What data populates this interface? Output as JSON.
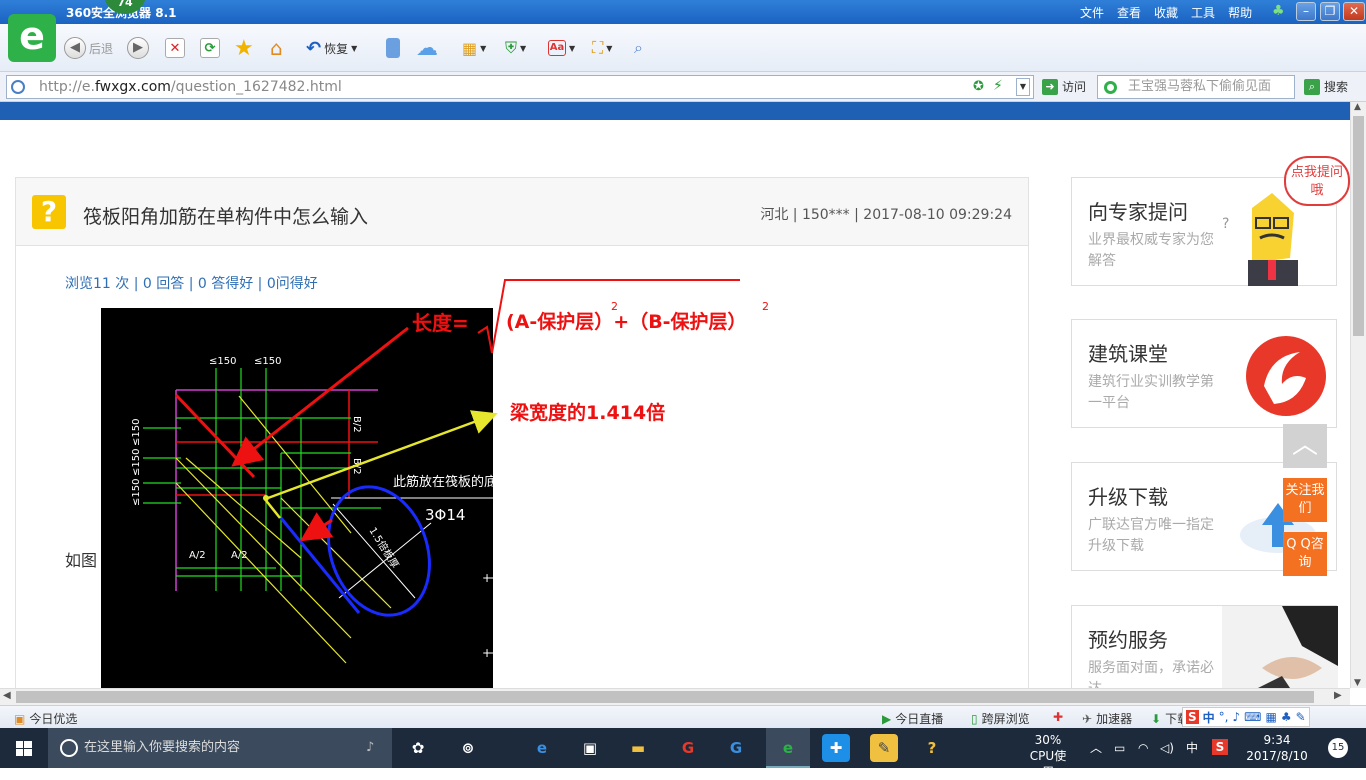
{
  "titlebar": {
    "title": "360安全浏览器 8.1",
    "badge": "74",
    "menu": [
      "文件",
      "查看",
      "收藏",
      "工具",
      "帮助"
    ]
  },
  "toolbar": {
    "back": "后退",
    "restore": "恢复"
  },
  "address": {
    "url_prefix": "http://e.",
    "url_domain": "fwxgx.com",
    "url_path": "/question_1627482.html",
    "visit": "访问",
    "search_value": "王宝强马蓉私下偷偷见面",
    "search_btn": "搜索"
  },
  "question": {
    "title": "筏板阳角加筋在单构件中怎么输入",
    "meta": "河北 | 150*** | 2017-08-10 09:29:24",
    "stats": "浏览11 次 | 0 回答 | 0 答得好 | 0问得好",
    "body_prefix": "如图"
  },
  "annotations": {
    "length_label": "长度=",
    "formula": "(A-保护层）+（B-保护层）",
    "sup": "2",
    "width_note": "梁宽度的1.414倍"
  },
  "cad": {
    "dim_150a": "≤150",
    "dim_150b": "≤150",
    "dim_b2a": "B/2",
    "dim_b2b": "B/2",
    "dim_a2a": "A/2",
    "dim_a2b": "A/2",
    "dim_150c": "≤150",
    "dim_150d": "≤150",
    "dim_150e": "≤150",
    "note_bottom": "此筋放在筏板的底部",
    "bar": "3Φ14",
    "diag": "1.5倍板厚",
    "colors": {
      "magenta": "#d23cd2",
      "green": "#22dd22",
      "yellow": "#e6e62e",
      "red": "#ee1111",
      "blue": "#1a2bff",
      "white": "#ffffff"
    }
  },
  "sidebar": [
    {
      "title": "向专家提问",
      "sub": "业界最权威专家为您解答"
    },
    {
      "title": "建筑课堂",
      "sub": "建筑行业实训教学第一平台"
    },
    {
      "title": "升级下载",
      "sub": "广联达官方唯一指定升级下载"
    },
    {
      "title": "预约服务",
      "sub": "服务面对面，承诺必达"
    }
  ],
  "bubble": "点我提问哦",
  "float": {
    "follow": "关注我们",
    "qq": "Q Q咨询"
  },
  "statusbar": {
    "left": "今日优选",
    "live": "今日直播",
    "cross": "跨屏浏览",
    "speed": "加速器",
    "download": "下载"
  },
  "taskbar": {
    "search_placeholder": "在这里输入你要搜索的内容",
    "cpu_pct": "30%",
    "cpu_label": "CPU使用",
    "ime": "中",
    "time": "9:34",
    "date": "2017/8/10",
    "notif": "15"
  }
}
